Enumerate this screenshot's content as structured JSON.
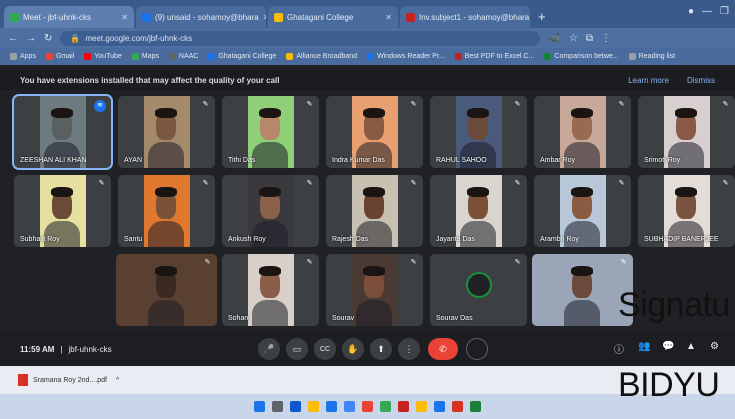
{
  "browser": {
    "tabs": [
      {
        "label": "Meet - jbf-uhnk-cks",
        "color": "#34a853"
      },
      {
        "label": "(9) unsaid - sohamoy@bhara",
        "color": "#1a73e8"
      },
      {
        "label": "Ghatagani College",
        "color": "#fbbc04"
      },
      {
        "label": "Inv.subject1 - sohamoy@bhara",
        "color": "#c5221f"
      }
    ],
    "new_tab": "+",
    "url": "meet.google.com/jbf-uhnk-cks",
    "bookmarks": [
      {
        "label": "Apps",
        "color": "#9aa0a6"
      },
      {
        "label": "Gmail",
        "color": "#ea4335"
      },
      {
        "label": "YouTube",
        "color": "#ff0000"
      },
      {
        "label": "Maps",
        "color": "#34a853"
      },
      {
        "label": "NAAC",
        "color": "#5f6368"
      },
      {
        "label": "Ghatagani College",
        "color": "#1a73e8"
      },
      {
        "label": "Alliance Broadband",
        "color": "#fbbc04"
      },
      {
        "label": "Windows Reader Pr...",
        "color": "#1a73e8"
      },
      {
        "label": "Best PDF to Excel C...",
        "color": "#c5221f"
      },
      {
        "label": "Comparison betwe...",
        "color": "#188038"
      },
      {
        "label": "Reading list",
        "color": "#9aa0a6"
      }
    ]
  },
  "notice": {
    "text": "You have extensions installed that may affect the quality of your call",
    "learn_more": "Learn more",
    "dismiss": "Dismiss"
  },
  "participants": [
    {
      "name": "ZEESHAN ALI KHAN",
      "row": 0,
      "col": 0,
      "bg": "#6d7a80",
      "skin": "#5a5f62",
      "highlight": true
    },
    {
      "name": "AYAN",
      "row": 0,
      "col": 1,
      "bg": "#a48a6a",
      "skin": "#7a5840"
    },
    {
      "name": "Tithi Das",
      "row": 0,
      "col": 2,
      "bg": "#8fcf78",
      "skin": "#b8876a"
    },
    {
      "name": "Indra Kumar Das",
      "row": 0,
      "col": 3,
      "bg": "#e8a070",
      "skin": "#8a5a40"
    },
    {
      "name": "RAHUL SAHOO",
      "row": 0,
      "col": 4,
      "bg": "#4a5a7a",
      "skin": "#6a4a3a"
    },
    {
      "name": "Ambar Roy",
      "row": 0,
      "col": 5,
      "bg": "#c8a898",
      "skin": "#9a6a50"
    },
    {
      "name": "Srimoti Roy",
      "row": 0,
      "col": 6,
      "bg": "#d8d0d0",
      "skin": "#8a5a48"
    },
    {
      "name": "Subhajit Roy",
      "row": 1,
      "col": 0,
      "bg": "#e6e0a0",
      "skin": "#6a4a38"
    },
    {
      "name": "Santu",
      "row": 1,
      "col": 1,
      "bg": "#e07830",
      "skin": "#7a5238"
    },
    {
      "name": "Ankush Roy",
      "row": 1,
      "col": 2,
      "bg": "#3a3a3e",
      "skin": "#8a6048"
    },
    {
      "name": "Rajesh Das",
      "row": 1,
      "col": 3,
      "bg": "#c8c0b0",
      "skin": "#6a4230"
    },
    {
      "name": "Jayanta Das",
      "row": 1,
      "col": 4,
      "bg": "#d8d4ce",
      "skin": "#7a5038"
    },
    {
      "name": "Arambh Roy",
      "row": 1,
      "col": 5,
      "bg": "#b8c8d8",
      "skin": "#8a5c42"
    },
    {
      "name": "SUBHADIP BANERJEE",
      "row": 1,
      "col": 6,
      "bg": "#e4dcd6",
      "skin": "#7a5440"
    },
    {
      "name": "",
      "row": 2,
      "col": 1,
      "bg": "#5a4030",
      "skin": "#3a2a22",
      "wide": true
    },
    {
      "name": "Sohan",
      "row": 2,
      "col": 2,
      "bg": "#d8d0c8",
      "skin": "#8a5e48"
    },
    {
      "name": "Sourav",
      "row": 2,
      "col": 3,
      "bg": "#4a3a34",
      "skin": "#7a4e38"
    },
    {
      "name": "Sourav Das",
      "row": 2,
      "col": 4,
      "bg": "#3c4043",
      "skin": "#202124",
      "avatar": true
    },
    {
      "name": "",
      "row": 2,
      "col": 5,
      "bg": "#9aa6b8",
      "skin": "#6a4a3a",
      "wide": true
    }
  ],
  "controls": {
    "time": "11:59 AM",
    "meeting_code": "jbf-uhnk-cks",
    "buttons": [
      "🎤",
      "▭",
      "CC",
      "✋",
      "⬆",
      "⋮"
    ],
    "end_call": "✆",
    "right_icons": [
      "ⓘ",
      "👥",
      "💬",
      "▲",
      "⚙"
    ]
  },
  "download": {
    "file": "Sramana Roy 2nd....pdf",
    "menu": "^"
  },
  "taskbar_colors": [
    "#1a73e8",
    "#5f6368",
    "#0b57d0",
    "#fbbc04",
    "#1a73e8",
    "#4285f4",
    "#ea4335",
    "#34a853",
    "#c5221f",
    "#fbbc04",
    "#1a73e8",
    "#d93025",
    "#188038"
  ],
  "overlay": {
    "signature": "Signatu",
    "name": "BIDYU"
  }
}
